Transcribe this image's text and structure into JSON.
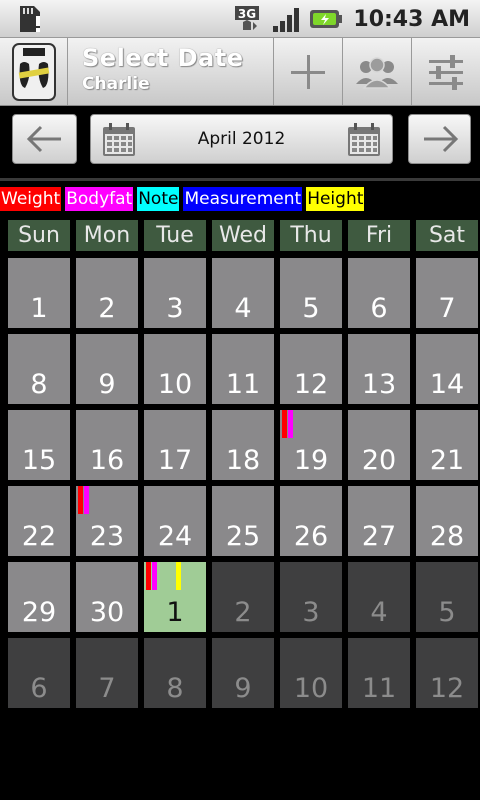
{
  "status_bar": {
    "time": "10:43 AM",
    "network": "3G"
  },
  "title_bar": {
    "title": "Select Date",
    "subtitle": "Charlie"
  },
  "navigation": {
    "month_label": "April 2012"
  },
  "legend": [
    {
      "label": "Weight",
      "bg": "#ff0000",
      "fg": "#ffffff"
    },
    {
      "label": "Bodyfat",
      "bg": "#ff00ff",
      "fg": "#ffffff"
    },
    {
      "label": "Note",
      "bg": "#00ffff",
      "fg": "#000000"
    },
    {
      "label": "Measurement",
      "bg": "#0000ff",
      "fg": "#ffffff"
    },
    {
      "label": "Height",
      "bg": "#ffff00",
      "fg": "#000000"
    }
  ],
  "weekdays": [
    "Sun",
    "Mon",
    "Tue",
    "Wed",
    "Thu",
    "Fri",
    "Sat"
  ],
  "weeks": [
    [
      {
        "day": "1",
        "type": "cur"
      },
      {
        "day": "2",
        "type": "cur"
      },
      {
        "day": "3",
        "type": "cur"
      },
      {
        "day": "4",
        "type": "cur"
      },
      {
        "day": "5",
        "type": "cur"
      },
      {
        "day": "6",
        "type": "cur"
      },
      {
        "day": "7",
        "type": "cur"
      }
    ],
    [
      {
        "day": "8",
        "type": "cur"
      },
      {
        "day": "9",
        "type": "cur"
      },
      {
        "day": "10",
        "type": "cur"
      },
      {
        "day": "11",
        "type": "cur"
      },
      {
        "day": "12",
        "type": "cur"
      },
      {
        "day": "13",
        "type": "cur"
      },
      {
        "day": "14",
        "type": "cur"
      }
    ],
    [
      {
        "day": "15",
        "type": "cur"
      },
      {
        "day": "16",
        "type": "cur"
      },
      {
        "day": "17",
        "type": "cur"
      },
      {
        "day": "18",
        "type": "cur"
      },
      {
        "day": "19",
        "type": "cur",
        "marks": [
          "Weight",
          "Bodyfat"
        ]
      },
      {
        "day": "20",
        "type": "cur"
      },
      {
        "day": "21",
        "type": "cur"
      }
    ],
    [
      {
        "day": "22",
        "type": "cur"
      },
      {
        "day": "23",
        "type": "cur",
        "marks": [
          "Weight",
          "Bodyfat"
        ]
      },
      {
        "day": "24",
        "type": "cur"
      },
      {
        "day": "25",
        "type": "cur"
      },
      {
        "day": "26",
        "type": "cur"
      },
      {
        "day": "27",
        "type": "cur"
      },
      {
        "day": "28",
        "type": "cur"
      }
    ],
    [
      {
        "day": "29",
        "type": "cur"
      },
      {
        "day": "30",
        "type": "cur"
      },
      {
        "day": "1",
        "type": "today",
        "marks": [
          "Weight",
          "Bodyfat",
          "Height"
        ]
      },
      {
        "day": "2",
        "type": "other"
      },
      {
        "day": "3",
        "type": "other"
      },
      {
        "day": "4",
        "type": "other"
      },
      {
        "day": "5",
        "type": "other"
      }
    ],
    [
      {
        "day": "6",
        "type": "other"
      },
      {
        "day": "7",
        "type": "other"
      },
      {
        "day": "8",
        "type": "other"
      },
      {
        "day": "9",
        "type": "other"
      },
      {
        "day": "10",
        "type": "other"
      },
      {
        "day": "11",
        "type": "other"
      },
      {
        "day": "12",
        "type": "other"
      }
    ]
  ],
  "colors": {
    "weekday_header_bg": "#3f5a40",
    "current_month_cell": "#8a898b",
    "other_month_cell": "#3f3f40",
    "today_cell": "#a0cc96"
  }
}
